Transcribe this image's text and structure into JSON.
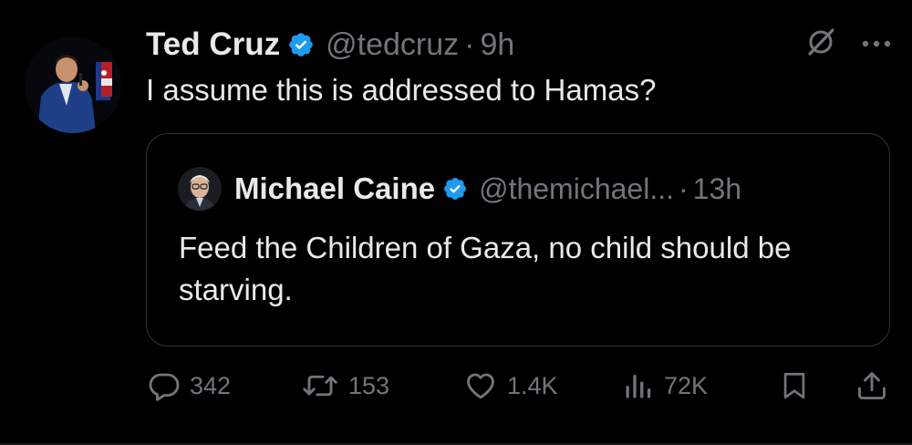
{
  "tweet": {
    "author_name": "Ted Cruz",
    "handle": "@tedcruz",
    "separator": "·",
    "time": "9h",
    "text": "I assume this is addressed to Hamas?"
  },
  "quoted_tweet": {
    "author_name": "Michael Caine",
    "handle": "@themichael...",
    "separator": "·",
    "time": "13h",
    "text": "Feed the Children of Gaza, no child should be starving."
  },
  "actions": {
    "replies": "342",
    "retweets": "153",
    "likes": "1.4K",
    "views": "72K"
  },
  "icons": [
    "verified-badge-icon",
    "grok-slash-icon",
    "more-icon",
    "reply-icon",
    "retweet-icon",
    "like-icon",
    "views-icon",
    "bookmark-icon",
    "share-icon"
  ],
  "colors": {
    "background": "#000000",
    "text_primary": "#e7e9ea",
    "text_secondary": "#71767b",
    "verified_blue": "#1d9bf0",
    "border": "#2f3336"
  }
}
